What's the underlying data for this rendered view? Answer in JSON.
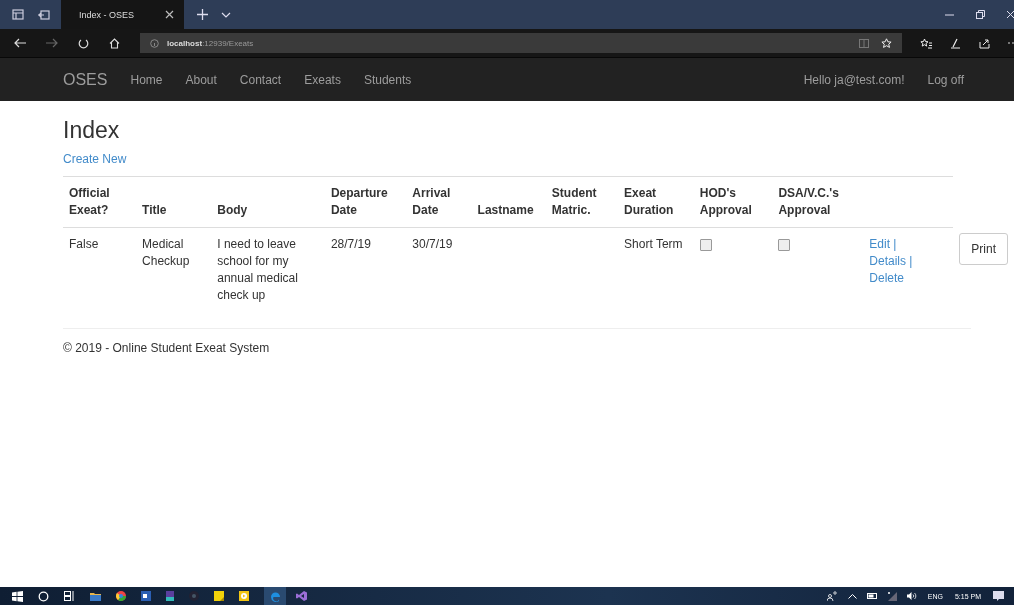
{
  "browser": {
    "tab_title": "Index - OSES",
    "url_host": "localhost",
    "url_path": ":12939/Exeats"
  },
  "navbar": {
    "brand": "OSES",
    "links": [
      "Home",
      "About",
      "Contact",
      "Exeats",
      "Students"
    ],
    "greeting": "Hello ja@test.com!",
    "logoff": "Log off"
  },
  "page": {
    "heading": "Index",
    "create_link": "Create New",
    "columns": [
      "Official Exeat?",
      "Title",
      "Body",
      "Departure Date",
      "Arrival Date",
      "Lastname",
      "Student Matric.",
      "Exeat Duration",
      "HOD's Approval",
      "DSA/V.C.'s Approval"
    ],
    "rows": [
      {
        "cells": [
          "False",
          "Medical Checkup",
          "I need to leave school for my annual medical check up",
          "28/7/19",
          "30/7/19",
          "",
          "",
          "Short Term"
        ],
        "hod_approval": false,
        "dsa_approval": false,
        "actions": [
          "Edit |",
          "Details |",
          "Delete"
        ],
        "print": "Print"
      }
    ]
  },
  "footer": "© 2019 - Online Student Exeat System",
  "taskbar": {
    "language": "ENG",
    "time": "5:15 PM"
  }
}
